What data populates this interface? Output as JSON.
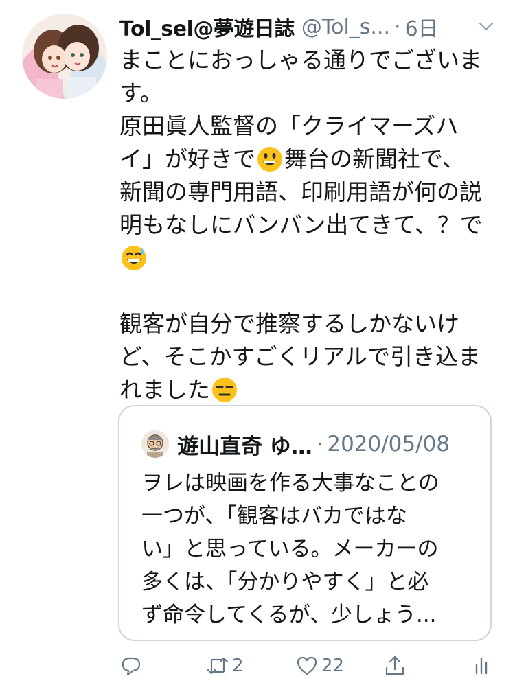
{
  "tweet": {
    "display_name": "Tol_sel@夢遊日誌",
    "handle": "@Tol_s...",
    "separator": "·",
    "time": "6日",
    "body_lines": [
      "まことにおっしゃる通りでございま",
      "す。",
      "原田眞人監督の「クライマーズハ",
      "イ」が好きで",
      "舞台の新聞社で、",
      "新聞の専門用語、印刷用語が何の説",
      "明もなしにバンバン出てきて、？で",
      "",
      "観客が自分で推察するしかないけ",
      "ど、そこかすごくリアルで引き込ま",
      "れました"
    ],
    "emojis": [
      "grinning-face",
      "grinning-sweat-face",
      "expressionless-face"
    ]
  },
  "quoted": {
    "display_name": "遊山直奇 ゆ…",
    "separator": "·",
    "date": "2020/05/08",
    "body_lines": [
      "ヲレは映画を作る大事なことの",
      "一つが、「観客はバカではな",
      "い」と思っている。メーカーの",
      "多くは、「分かりやすく」と必",
      "ず命令してくるが、少しょう..."
    ]
  },
  "actions": {
    "reply_count": "",
    "retweet_count": "2",
    "like_count": "22",
    "share_count": ""
  },
  "colors": {
    "text": "#14171a",
    "secondary": "#657786",
    "border": "#ccd6dd",
    "emoji_yellow": "#fcc21b"
  }
}
